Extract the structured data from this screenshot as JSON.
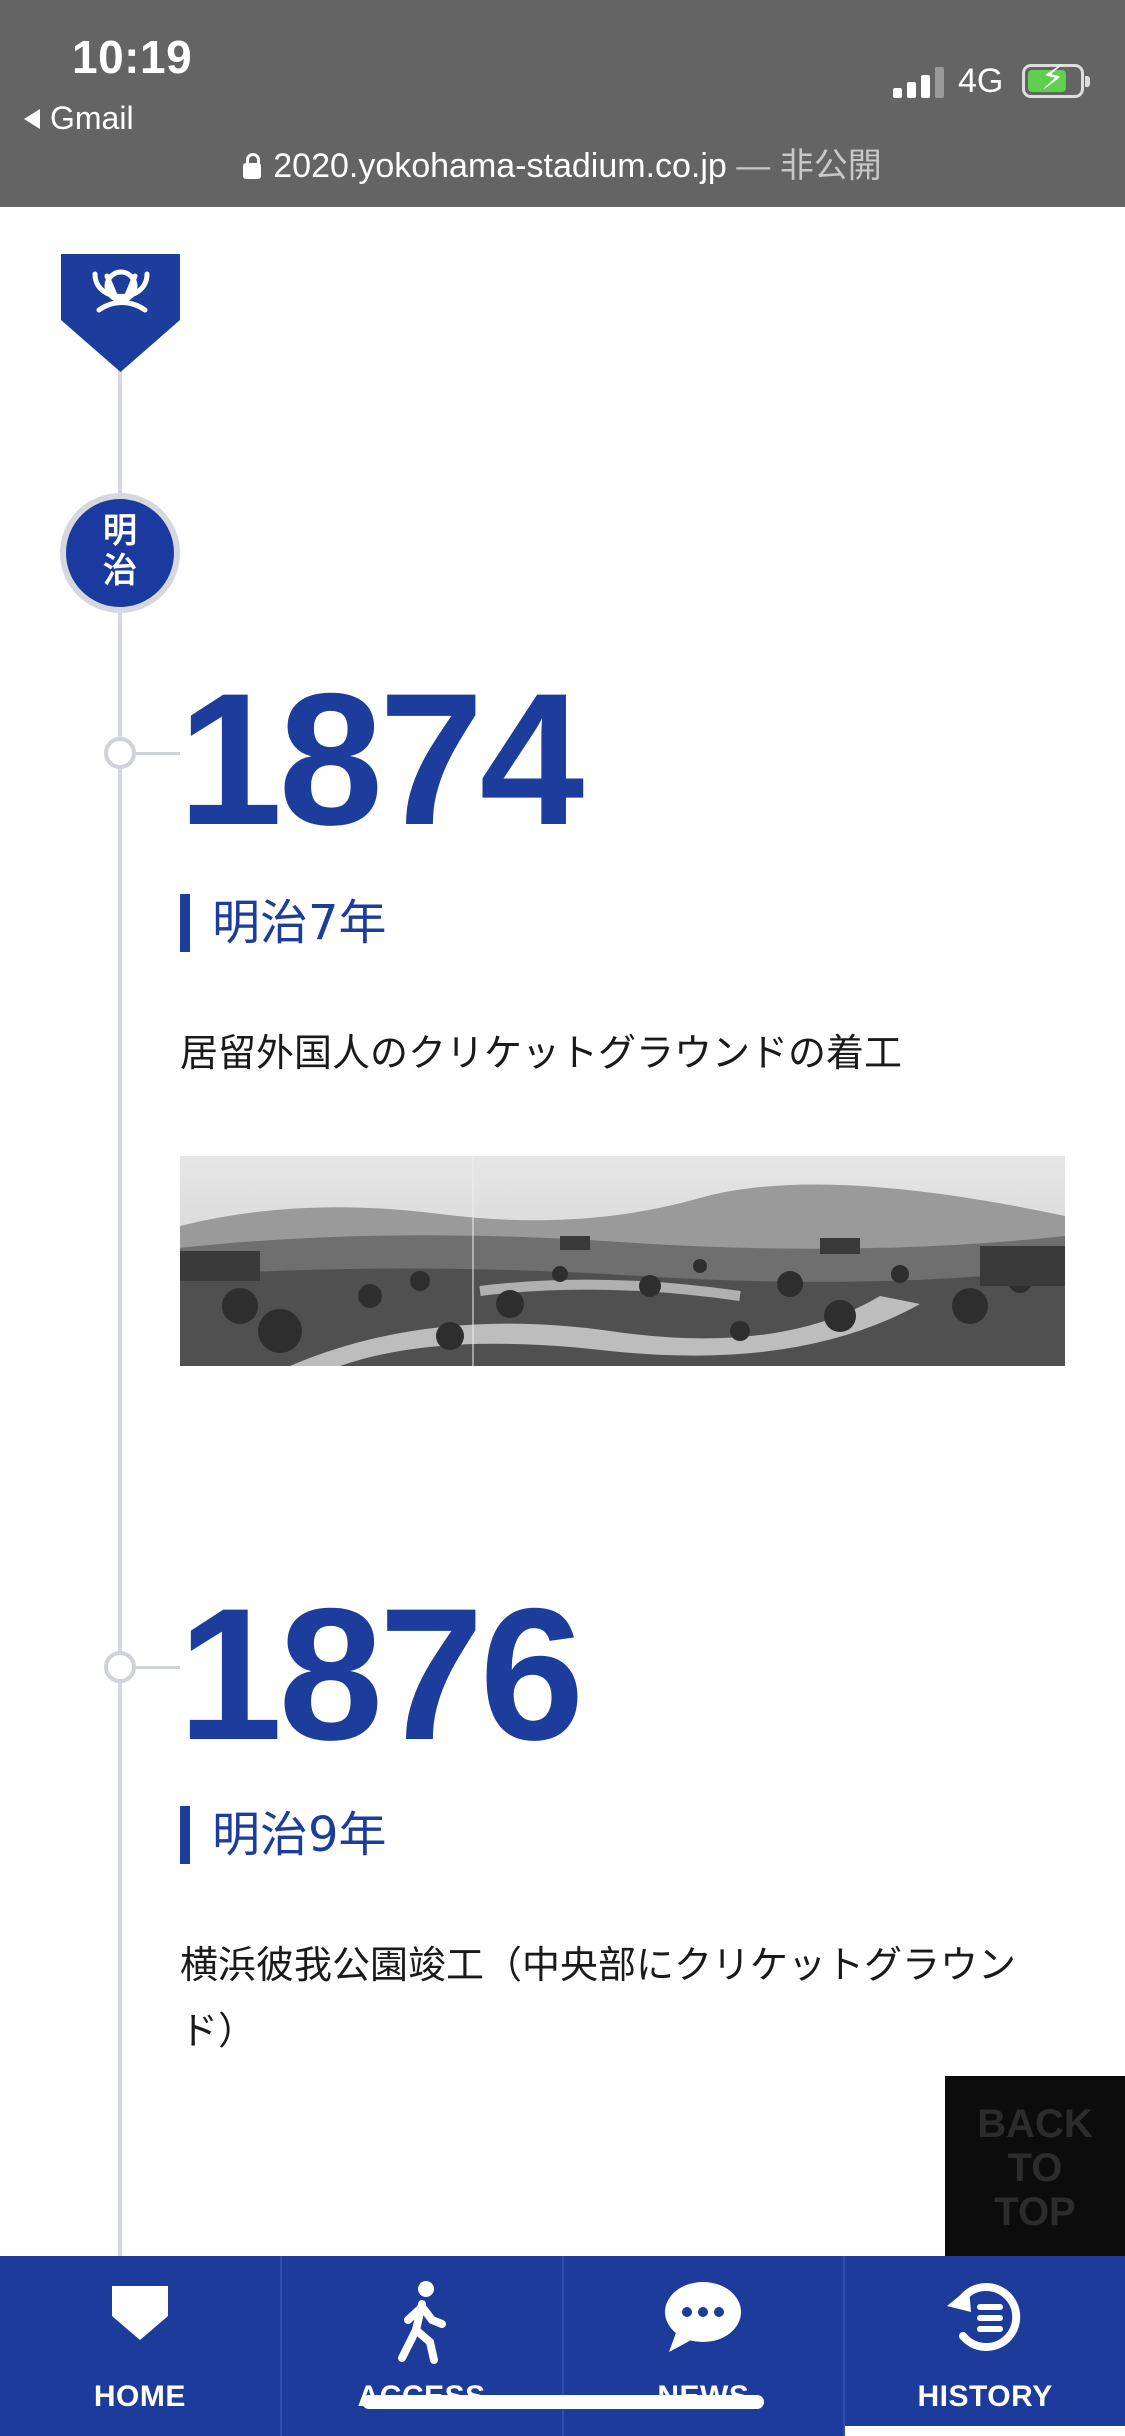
{
  "status_bar": {
    "time": "10:19",
    "back_app": "Gmail",
    "network": "4G"
  },
  "url_bar": {
    "domain": "2020.yokohama-stadium.co.jp",
    "separator": "—",
    "suffix": "非公開"
  },
  "timeline": {
    "era_badge": [
      "明",
      "治"
    ],
    "entries": [
      {
        "year": "1874",
        "era_year": "明治7年",
        "description": "居留外国人のクリケットグラウンドの着工"
      },
      {
        "year": "1876",
        "era_year": "明治9年",
        "description": "横浜彼我公園竣工（中央部にクリケットグラウンド）"
      }
    ]
  },
  "back_to_top": {
    "line1": "BACK",
    "line2": "TO",
    "line3": "TOP"
  },
  "bottom_nav": [
    {
      "label": "HOME",
      "icon": "home-plate-icon"
    },
    {
      "label": "ACCESS",
      "icon": "walking-person-icon"
    },
    {
      "label": "NEWS",
      "icon": "chat-bubble-icon"
    },
    {
      "label": "HISTORY",
      "icon": "history-icon"
    }
  ],
  "colors": {
    "brand": "#1c3d9c",
    "status_bar": "#646464",
    "timeline_line": "#d6d8df"
  }
}
